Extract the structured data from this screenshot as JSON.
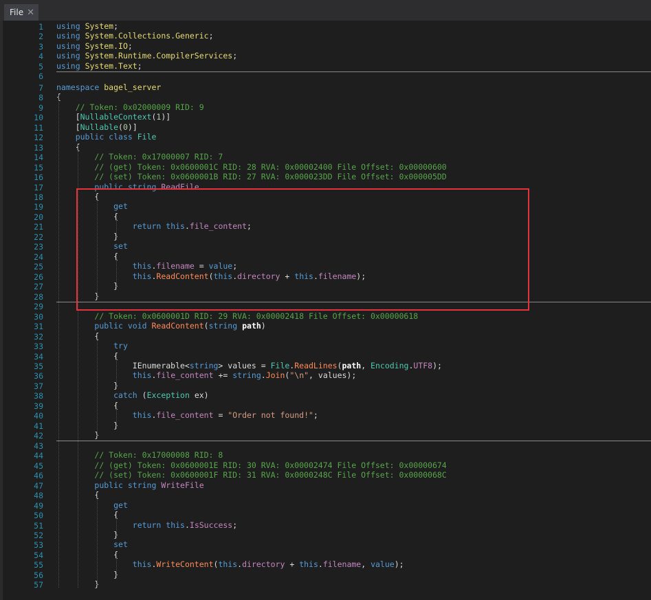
{
  "tab": {
    "label": "File",
    "close_glyph": "✕"
  },
  "colors": {
    "keyword": "#569cd6",
    "namespace": "#e6db74",
    "type": "#4ec9b0",
    "comment": "#57a64a",
    "number": "#b5cea8",
    "property": "#c586c0",
    "method": "#ff8c5a",
    "string": "#d69d85",
    "line_number": "#2b91af",
    "highlight_box": "#e5333d"
  },
  "lines": [
    {
      "n": "1",
      "tokens": [
        [
          "kw",
          "using"
        ],
        [
          "pl",
          " "
        ],
        [
          "ns",
          "System"
        ],
        [
          "pl",
          ";"
        ]
      ]
    },
    {
      "n": "2",
      "tokens": [
        [
          "kw",
          "using"
        ],
        [
          "pl",
          " "
        ],
        [
          "ns",
          "System.Collections.Generic"
        ],
        [
          "pl",
          ";"
        ]
      ]
    },
    {
      "n": "3",
      "tokens": [
        [
          "kw",
          "using"
        ],
        [
          "pl",
          " "
        ],
        [
          "ns",
          "System.IO"
        ],
        [
          "pl",
          ";"
        ]
      ]
    },
    {
      "n": "4",
      "tokens": [
        [
          "kw",
          "using"
        ],
        [
          "pl",
          " "
        ],
        [
          "ns",
          "System.Runtime.CompilerServices"
        ],
        [
          "pl",
          ";"
        ]
      ]
    },
    {
      "n": "5",
      "tokens": [
        [
          "kw",
          "using"
        ],
        [
          "pl",
          " "
        ],
        [
          "ns",
          "System.Text"
        ],
        [
          "pl",
          ";"
        ]
      ]
    },
    {
      "n": "6",
      "tokens": []
    },
    {
      "n": "7",
      "tokens": [
        [
          "kw",
          "namespace"
        ],
        [
          "pl",
          " "
        ],
        [
          "ns",
          "bagel_server"
        ]
      ]
    },
    {
      "n": "8",
      "tokens": [
        [
          "pl",
          "{"
        ]
      ]
    },
    {
      "n": "9",
      "tokens": [
        [
          "pl",
          "    "
        ],
        [
          "cm",
          "// Token: 0x02000009 RID: 9"
        ]
      ]
    },
    {
      "n": "10",
      "tokens": [
        [
          "pl",
          "    ["
        ],
        [
          "ty",
          "NullableContext"
        ],
        [
          "pl",
          "("
        ],
        [
          "nm",
          "1"
        ],
        [
          "pl",
          ")]"
        ]
      ]
    },
    {
      "n": "11",
      "tokens": [
        [
          "pl",
          "    ["
        ],
        [
          "ty",
          "Nullable"
        ],
        [
          "pl",
          "("
        ],
        [
          "nm",
          "0"
        ],
        [
          "pl",
          ")]"
        ]
      ]
    },
    {
      "n": "12",
      "tokens": [
        [
          "pl",
          "    "
        ],
        [
          "kw",
          "public class"
        ],
        [
          "pl",
          " "
        ],
        [
          "ty",
          "File"
        ]
      ]
    },
    {
      "n": "13",
      "tokens": [
        [
          "pl",
          "    {"
        ]
      ]
    },
    {
      "n": "14",
      "tokens": [
        [
          "pl",
          "        "
        ],
        [
          "cm",
          "// Token: 0x17000007 RID: 7"
        ]
      ]
    },
    {
      "n": "15",
      "tokens": [
        [
          "pl",
          "        "
        ],
        [
          "cm",
          "// (get) Token: 0x0600001C RID: 28 RVA: 0x00002400 File Offset: 0x00000600"
        ]
      ]
    },
    {
      "n": "16",
      "tokens": [
        [
          "pl",
          "        "
        ],
        [
          "cm",
          "// (set) Token: 0x0600001B RID: 27 RVA: 0x000023DD File Offset: 0x000005DD"
        ]
      ]
    },
    {
      "n": "17",
      "tokens": [
        [
          "pl",
          "        "
        ],
        [
          "kw",
          "public string"
        ],
        [
          "pl",
          " "
        ],
        [
          "pr",
          "ReadFile"
        ]
      ]
    },
    {
      "n": "18",
      "tokens": [
        [
          "pl",
          "        {"
        ]
      ]
    },
    {
      "n": "19",
      "tokens": [
        [
          "pl",
          "            "
        ],
        [
          "kw",
          "get"
        ]
      ]
    },
    {
      "n": "20",
      "tokens": [
        [
          "pl",
          "            {"
        ]
      ]
    },
    {
      "n": "21",
      "tokens": [
        [
          "pl",
          "                "
        ],
        [
          "kw",
          "return"
        ],
        [
          "pl",
          " "
        ],
        [
          "kw",
          "this"
        ],
        [
          "pl",
          "."
        ],
        [
          "pr",
          "file_content"
        ],
        [
          "pl",
          ";"
        ]
      ]
    },
    {
      "n": "22",
      "tokens": [
        [
          "pl",
          "            }"
        ]
      ]
    },
    {
      "n": "23",
      "tokens": [
        [
          "pl",
          "            "
        ],
        [
          "kw",
          "set"
        ]
      ]
    },
    {
      "n": "24",
      "tokens": [
        [
          "pl",
          "            {"
        ]
      ]
    },
    {
      "n": "25",
      "tokens": [
        [
          "pl",
          "                "
        ],
        [
          "kw",
          "this"
        ],
        [
          "pl",
          "."
        ],
        [
          "pr",
          "filename"
        ],
        [
          "pl",
          " = "
        ],
        [
          "kw",
          "value"
        ],
        [
          "pl",
          ";"
        ]
      ]
    },
    {
      "n": "26",
      "tokens": [
        [
          "pl",
          "                "
        ],
        [
          "kw",
          "this"
        ],
        [
          "pl",
          "."
        ],
        [
          "mt",
          "ReadContent"
        ],
        [
          "pl",
          "("
        ],
        [
          "kw",
          "this"
        ],
        [
          "pl",
          "."
        ],
        [
          "pr",
          "directory"
        ],
        [
          "pl",
          " + "
        ],
        [
          "kw",
          "this"
        ],
        [
          "pl",
          "."
        ],
        [
          "pr",
          "filename"
        ],
        [
          "pl",
          ");"
        ]
      ]
    },
    {
      "n": "27",
      "tokens": [
        [
          "pl",
          "            }"
        ]
      ]
    },
    {
      "n": "28",
      "tokens": [
        [
          "pl",
          "        }"
        ]
      ]
    },
    {
      "n": "29",
      "tokens": []
    },
    {
      "n": "30",
      "tokens": [
        [
          "pl",
          "        "
        ],
        [
          "cm",
          "// Token: 0x0600001D RID: 29 RVA: 0x00002418 File Offset: 0x00000618"
        ]
      ]
    },
    {
      "n": "31",
      "tokens": [
        [
          "pl",
          "        "
        ],
        [
          "kw",
          "public void"
        ],
        [
          "pl",
          " "
        ],
        [
          "mt",
          "ReadContent"
        ],
        [
          "pl",
          "("
        ],
        [
          "kw",
          "string"
        ],
        [
          "pl",
          " "
        ],
        [
          "bo",
          "path"
        ],
        [
          "pl",
          ")"
        ]
      ]
    },
    {
      "n": "32",
      "tokens": [
        [
          "pl",
          "        {"
        ]
      ]
    },
    {
      "n": "33",
      "tokens": [
        [
          "pl",
          "            "
        ],
        [
          "kw",
          "try"
        ]
      ]
    },
    {
      "n": "34",
      "tokens": [
        [
          "pl",
          "            {"
        ]
      ]
    },
    {
      "n": "35",
      "tokens": [
        [
          "pl",
          "                IEnumerable<"
        ],
        [
          "kw",
          "string"
        ],
        [
          "pl",
          "> values = "
        ],
        [
          "ty",
          "File"
        ],
        [
          "pl",
          "."
        ],
        [
          "mt",
          "ReadLines"
        ],
        [
          "pl",
          "("
        ],
        [
          "bo",
          "path"
        ],
        [
          "pl",
          ", "
        ],
        [
          "ty",
          "Encoding"
        ],
        [
          "pl",
          "."
        ],
        [
          "pr",
          "UTF8"
        ],
        [
          "pl",
          ");"
        ]
      ]
    },
    {
      "n": "36",
      "tokens": [
        [
          "pl",
          "                "
        ],
        [
          "kw",
          "this"
        ],
        [
          "pl",
          "."
        ],
        [
          "pr",
          "file_content"
        ],
        [
          "pl",
          " += "
        ],
        [
          "kw",
          "string"
        ],
        [
          "pl",
          "."
        ],
        [
          "mt",
          "Join"
        ],
        [
          "pl",
          "("
        ],
        [
          "st",
          "\"\\n\""
        ],
        [
          "pl",
          ", values);"
        ]
      ]
    },
    {
      "n": "37",
      "tokens": [
        [
          "pl",
          "            }"
        ]
      ]
    },
    {
      "n": "38",
      "tokens": [
        [
          "pl",
          "            "
        ],
        [
          "kw",
          "catch"
        ],
        [
          "pl",
          " ("
        ],
        [
          "ty",
          "Exception"
        ],
        [
          "pl",
          " ex)"
        ]
      ]
    },
    {
      "n": "39",
      "tokens": [
        [
          "pl",
          "            {"
        ]
      ]
    },
    {
      "n": "40",
      "tokens": [
        [
          "pl",
          "                "
        ],
        [
          "kw",
          "this"
        ],
        [
          "pl",
          "."
        ],
        [
          "pr",
          "file_content"
        ],
        [
          "pl",
          " = "
        ],
        [
          "st",
          "\"Order not found!\""
        ],
        [
          "pl",
          ";"
        ]
      ]
    },
    {
      "n": "41",
      "tokens": [
        [
          "pl",
          "            }"
        ]
      ]
    },
    {
      "n": "42",
      "tokens": [
        [
          "pl",
          "        }"
        ]
      ]
    },
    {
      "n": "43",
      "tokens": []
    },
    {
      "n": "44",
      "tokens": [
        [
          "pl",
          "        "
        ],
        [
          "cm",
          "// Token: 0x17000008 RID: 8"
        ]
      ]
    },
    {
      "n": "45",
      "tokens": [
        [
          "pl",
          "        "
        ],
        [
          "cm",
          "// (get) Token: 0x0600001E RID: 30 RVA: 0x00002474 File Offset: 0x00000674"
        ]
      ]
    },
    {
      "n": "46",
      "tokens": [
        [
          "pl",
          "        "
        ],
        [
          "cm",
          "// (set) Token: 0x0600001F RID: 31 RVA: 0x0000248C File Offset: 0x0000068C"
        ]
      ]
    },
    {
      "n": "47",
      "tokens": [
        [
          "pl",
          "        "
        ],
        [
          "kw",
          "public string"
        ],
        [
          "pl",
          " "
        ],
        [
          "pr",
          "WriteFile"
        ]
      ]
    },
    {
      "n": "48",
      "tokens": [
        [
          "pl",
          "        {"
        ]
      ]
    },
    {
      "n": "49",
      "tokens": [
        [
          "pl",
          "            "
        ],
        [
          "kw",
          "get"
        ]
      ]
    },
    {
      "n": "50",
      "tokens": [
        [
          "pl",
          "            {"
        ]
      ]
    },
    {
      "n": "51",
      "tokens": [
        [
          "pl",
          "                "
        ],
        [
          "kw",
          "return"
        ],
        [
          "pl",
          " "
        ],
        [
          "kw",
          "this"
        ],
        [
          "pl",
          "."
        ],
        [
          "pr",
          "IsSuccess"
        ],
        [
          "pl",
          ";"
        ]
      ]
    },
    {
      "n": "52",
      "tokens": [
        [
          "pl",
          "            }"
        ]
      ]
    },
    {
      "n": "53",
      "tokens": [
        [
          "pl",
          "            "
        ],
        [
          "kw",
          "set"
        ]
      ]
    },
    {
      "n": "54",
      "tokens": [
        [
          "pl",
          "            {"
        ]
      ]
    },
    {
      "n": "55",
      "tokens": [
        [
          "pl",
          "                "
        ],
        [
          "kw",
          "this"
        ],
        [
          "pl",
          "."
        ],
        [
          "mt",
          "WriteContent"
        ],
        [
          "pl",
          "("
        ],
        [
          "kw",
          "this"
        ],
        [
          "pl",
          "."
        ],
        [
          "pr",
          "directory"
        ],
        [
          "pl",
          " + "
        ],
        [
          "kw",
          "this"
        ],
        [
          "pl",
          "."
        ],
        [
          "pr",
          "filename"
        ],
        [
          "pl",
          ", "
        ],
        [
          "kw",
          "value"
        ],
        [
          "pl",
          ");"
        ]
      ]
    },
    {
      "n": "56",
      "tokens": [
        [
          "pl",
          "            }"
        ]
      ]
    },
    {
      "n": "57",
      "tokens": [
        [
          "pl",
          "        }"
        ]
      ]
    }
  ]
}
